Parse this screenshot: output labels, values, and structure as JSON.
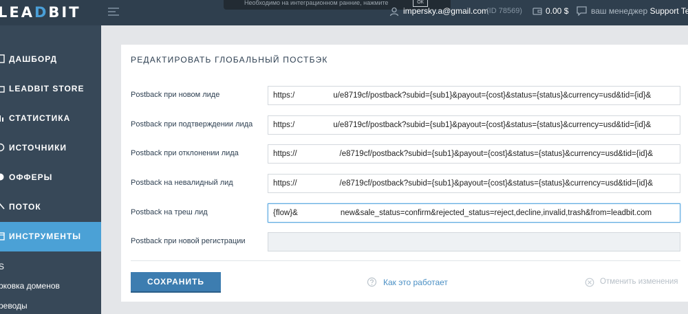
{
  "app": {
    "logo_a": "LEA",
    "logo_b": "D",
    "logo_c": "BIT"
  },
  "topbar": {
    "notice_text": "Необходимо на интеграционном ранние, нажмите",
    "notice_button": "ОК",
    "user_email": "impersky.a@gmail.com",
    "user_id": "(ID 78569)",
    "balance": "0.00 $",
    "manager_label": "ваш менеджер",
    "manager_name": "Support Tea"
  },
  "sidebar": {
    "items": [
      {
        "label": "ДАШБОРД",
        "icon": "dashboard-icon"
      },
      {
        "label": "LEADBIT STORE",
        "icon": "store-icon"
      },
      {
        "label": "СТАТИСТИКА",
        "icon": "statistics-icon"
      },
      {
        "label": "ИСТОЧНИКИ",
        "icon": "sources-icon"
      },
      {
        "label": "ОФФЕРЫ",
        "icon": "offers-icon"
      },
      {
        "label": "ПОТОК",
        "icon": "flow-icon"
      },
      {
        "label": "ИНСТРУМЕНТЫ",
        "icon": "tools-icon",
        "active": true
      }
    ],
    "subitems": [
      "S",
      "рковка доменов",
      "реводы"
    ]
  },
  "form": {
    "title": "РЕДАКТИРОВАТЬ ГЛОБАЛЬНЫЙ ПОСТБЭК",
    "rows": [
      {
        "label": "Postback при новом лиде",
        "value_start": "https:/",
        "value_end": "u/e8719cf/postback?subid={sub1}&payout={cost}&status={status}&currency=usd&tid={id}&"
      },
      {
        "label": "Postback при подтверждении лида",
        "value_start": "https:/",
        "value_end": "u/e8719cf/postback?subid={sub1}&payout={cost}&status={status}&currency=usd&tid={id}&"
      },
      {
        "label": "Postback при отклонении лида",
        "value_start": "https://",
        "value_end": "/e8719cf/postback?subid={sub1}&payout={cost}&status={status}&currency=usd&tid={id}&"
      },
      {
        "label": "Postback на невалидный лид",
        "value_start": "https://",
        "value_end": "/e8719cf/postback?subid={sub1}&payout={cost}&status={status}&currency=usd&tid={id}&"
      },
      {
        "label": "Postback на треш лид",
        "value_start": "{flow}&",
        "value_end": "new&sale_status=confirm&rejected_status=reject,decline,invalid,trash&from=leadbit.com"
      },
      {
        "label": "Postback при новой регистрации",
        "value_start": "",
        "value_end": ""
      }
    ],
    "save_label": "СОХРАНИТЬ",
    "how_label": "Как это работает",
    "cancel_label": "Отменить изменения"
  },
  "colors": {
    "topbar": "#2f3f4e",
    "sidebar": "#374858",
    "accent": "#4ba1d6",
    "save_button": "#3d7db0"
  }
}
